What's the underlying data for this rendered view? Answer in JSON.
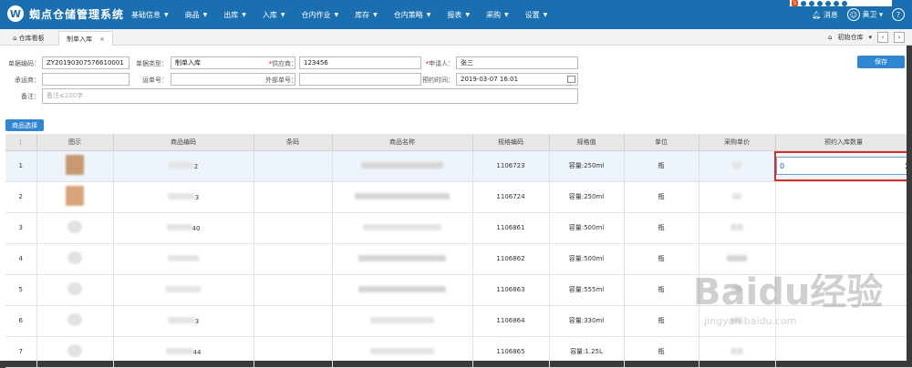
{
  "app": {
    "title": "蜘点仓储管理系统",
    "logo_letter": "W"
  },
  "menu": [
    {
      "label": "基础信息"
    },
    {
      "label": "商品"
    },
    {
      "label": "出库"
    },
    {
      "label": "入库"
    },
    {
      "label": "仓内作业"
    },
    {
      "label": "库存"
    },
    {
      "label": "仓内策略"
    },
    {
      "label": "报表"
    },
    {
      "label": "采购"
    },
    {
      "label": "设置"
    }
  ],
  "topright": {
    "message": "消息",
    "user": "黄卫",
    "help": "?"
  },
  "tabs": {
    "home": "仓库看板",
    "active": "制单入库",
    "close": "×",
    "warehouse": "初始仓库"
  },
  "form": {
    "order_no_label": "单据编码：",
    "order_no": "ZY20190307576610001",
    "order_type_label": "单据类型：",
    "order_type": "制单入库",
    "supplier_label": "供应商：",
    "supplier": "123456",
    "applicant_label": "申请人：",
    "applicant": "张三",
    "carrier_label": "承运商：",
    "waybill_label": "运单号：",
    "external_no_label": "外部单号：",
    "eta_label": "预约时间：",
    "eta": "2019-03-07 16:01",
    "remark_label": "备注：",
    "remark_placeholder": "备注≤200字",
    "save": "保存",
    "select_goods": "商品选择"
  },
  "table": {
    "headers": [
      "图示",
      "商品编码",
      "条码",
      "商品名称",
      "规格编码",
      "规格值",
      "单位",
      "采购单价",
      "预约入库数量"
    ],
    "rows": [
      {
        "no": "1",
        "code_tail": "2",
        "spec_code": "1106723",
        "spec": "容量:250ml",
        "unit": "瓶",
        "qty": "0"
      },
      {
        "no": "2",
        "code_tail": "3",
        "spec_code": "1106724",
        "spec": "容量:250ml",
        "unit": "瓶",
        "qty": ""
      },
      {
        "no": "3",
        "code_tail": "40",
        "spec_code": "1106861",
        "spec": "容量:500ml",
        "unit": "瓶",
        "qty": ""
      },
      {
        "no": "4",
        "code_tail": "",
        "spec_code": "1106862",
        "spec": "容量:500ml",
        "unit": "瓶",
        "qty": ""
      },
      {
        "no": "5",
        "code_tail": "",
        "spec_code": "1106863",
        "spec": "容量:555ml",
        "unit": "瓶",
        "qty": ""
      },
      {
        "no": "6",
        "code_tail": "3",
        "spec_code": "1106864",
        "spec": "容量:330ml",
        "unit": "瓶",
        "qty": ""
      },
      {
        "no": "7",
        "code_tail": "44",
        "spec_code": "1106865",
        "spec": "容量:1.25L",
        "unit": "瓶",
        "qty": ""
      }
    ]
  },
  "watermark": {
    "main": "Baidu经验",
    "sub": "jingyan.baidu.com"
  }
}
